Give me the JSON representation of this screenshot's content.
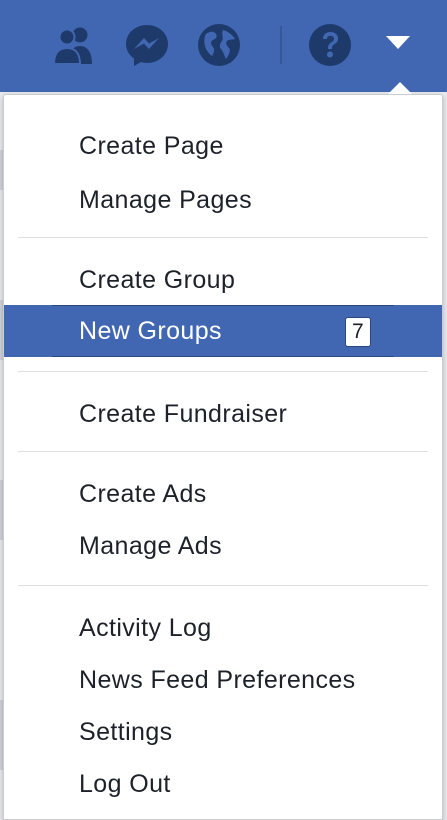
{
  "topbar": {
    "bg_color": "#4267b2",
    "icons": [
      "friends-icon",
      "messenger-icon",
      "globe-icon",
      "help-icon",
      "dropdown-arrow-icon"
    ]
  },
  "menu": {
    "sections": [
      {
        "items": [
          {
            "label": "Create Page"
          },
          {
            "label": "Manage Pages"
          }
        ]
      },
      {
        "items": [
          {
            "label": "Create Group"
          },
          {
            "label": "New Groups",
            "badge": "7",
            "highlighted": true
          }
        ]
      },
      {
        "items": [
          {
            "label": "Create Fundraiser"
          }
        ]
      },
      {
        "items": [
          {
            "label": "Create Ads"
          },
          {
            "label": "Manage Ads"
          }
        ]
      },
      {
        "items": [
          {
            "label": "Activity Log"
          },
          {
            "label": "News Feed Preferences"
          },
          {
            "label": "Settings"
          },
          {
            "label": "Log Out"
          }
        ]
      }
    ],
    "highlight_color": "#4267b2"
  }
}
